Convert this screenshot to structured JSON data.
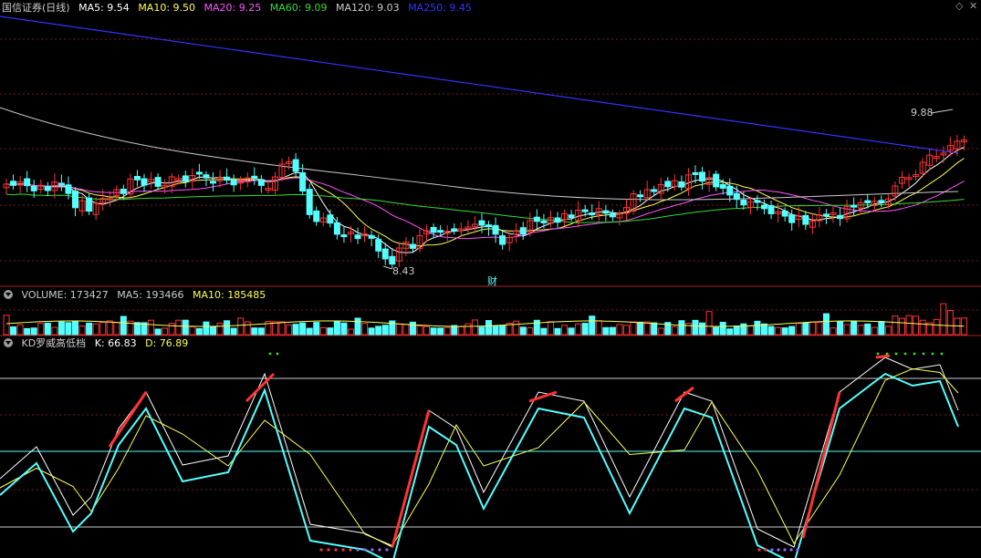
{
  "header": {
    "title": "国信证券(日线)",
    "ma5": "MA5: 9.54",
    "ma10": "MA10: 9.50",
    "ma20": "MA20: 9.25",
    "ma60": "MA60: 9.09",
    "ma120": "MA120: 9.03",
    "ma250": "MA250: 9.45"
  },
  "volume": {
    "title": "VOLUME: 173427",
    "ma5": "MA5: 193466",
    "ma10": "MA10: 185485"
  },
  "kd": {
    "title": "KD罗威高低档",
    "k": "K: 66.83",
    "d": "D: 76.89"
  },
  "annotations": {
    "high": "9.88",
    "low": "8.43",
    "fin_marker": "财"
  },
  "icons": [
    "collapse-icon",
    "diamond-icon",
    "close-icon"
  ],
  "colors": {
    "up": "#ff3333",
    "down": "#54ffff",
    "ma5": "#ffffff",
    "ma10": "#ffff55",
    "ma20": "#ff55ff",
    "ma60": "#33dd33",
    "ma120": "#cccccc",
    "ma250": "#3333ff",
    "k": "#ffffff",
    "d": "#ffff55"
  }
}
